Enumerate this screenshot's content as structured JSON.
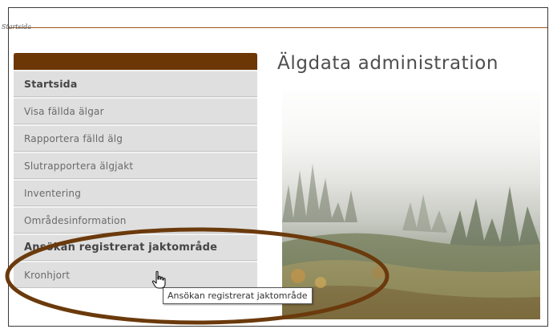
{
  "breadcrumb": {
    "label": "Startsida"
  },
  "page": {
    "title": "Älgdata administration"
  },
  "sidebar": {
    "items": [
      {
        "label": "Startsida"
      },
      {
        "label": "Visa fällda älgar"
      },
      {
        "label": "Rapportera fälld älg"
      },
      {
        "label": "Slutrapportera älgjakt"
      },
      {
        "label": "Inventering"
      },
      {
        "label": "Områdesinformation"
      },
      {
        "label": "Ansökan registrerat jaktområde"
      },
      {
        "label": "Kronhjort"
      }
    ]
  },
  "tooltip": {
    "text": "Ansökan registrerat jaktområde"
  },
  "icons": {
    "cursor": "hand-pointer-icon"
  },
  "colors": {
    "sidebar_header": "#6d3705",
    "annotation_ellipse": "#6b3a0c",
    "topbar_border": "#a0551a"
  }
}
